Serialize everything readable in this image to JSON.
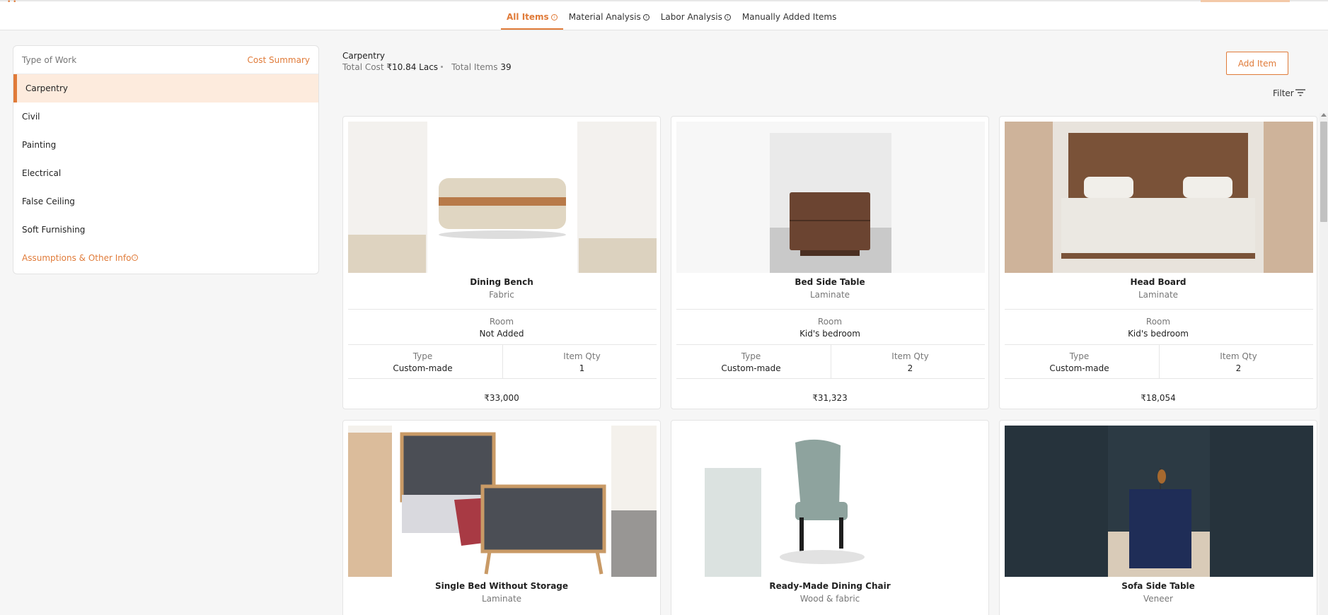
{
  "tabs": [
    {
      "label": "All Items",
      "info": "i"
    },
    {
      "label": "Material Analysis",
      "info": "i"
    },
    {
      "label": "Labor Analysis",
      "info": "i"
    },
    {
      "label": "Manually Added Items"
    }
  ],
  "sidebar": {
    "header_left": "Type of Work",
    "header_right": "Cost Summary",
    "items": [
      "Carpentry",
      "Civil",
      "Painting",
      "Electrical",
      "False Ceiling",
      "Soft Furnishing"
    ],
    "footer_link": "Assumptions & Other Info",
    "footer_info": "i"
  },
  "summary": {
    "category": "Carpentry",
    "total_cost_label": "Total Cost",
    "total_cost_value": "₹10.84 Lacs",
    "total_items_label": "Total Items",
    "total_items_value": "39"
  },
  "actions": {
    "add_item": "Add Item",
    "filter": "Filter"
  },
  "labels": {
    "room": "Room",
    "type": "Type",
    "qty": "Item Qty"
  },
  "cards": [
    {
      "name": "Dining Bench",
      "material": "Fabric",
      "room": "Not Added",
      "type": "Custom-made",
      "qty": "1",
      "price": "₹33,000"
    },
    {
      "name": "Bed Side Table",
      "material": "Laminate",
      "room": "Kid's bedroom",
      "type": "Custom-made",
      "qty": "2",
      "price": "₹31,323"
    },
    {
      "name": "Head Board",
      "material": "Laminate",
      "room": "Kid's bedroom",
      "type": "Custom-made",
      "qty": "2",
      "price": "₹18,054"
    },
    {
      "name": "Single Bed Without Storage",
      "material": "Laminate"
    },
    {
      "name": "Ready-Made Dining Chair",
      "material": "Wood & fabric"
    },
    {
      "name": "Sofa Side Table",
      "material": "Veneer"
    }
  ],
  "colors": {
    "accent": "#e07b39",
    "active_bg": "#fdebdd"
  }
}
